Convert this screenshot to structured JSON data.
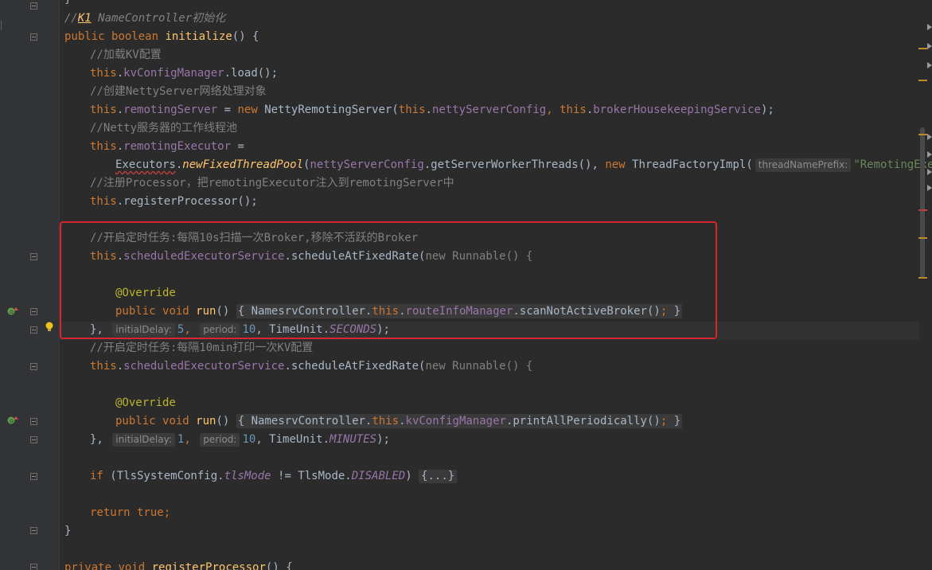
{
  "lines": [
    {
      "id": "l0",
      "text": "}"
    },
    {
      "id": "l1",
      "comment_prefix": "//",
      "comment_tag": "K1",
      "comment_rest": " NameController初始化"
    },
    {
      "kw1": "public",
      "kw2": "boolean",
      "method": "initialize",
      "rest": "() {"
    },
    {
      "comment": "//加载KV配置"
    },
    {
      "this": "this",
      "field": "kvConfigManager",
      "rest1": ".",
      "method": "load",
      "rest2": "();"
    },
    {
      "comment": "//创建NettyServer网络处理对象"
    },
    {
      "this": "this",
      "field": "remotingServer",
      "op": " = ",
      "kw": "new",
      "cls": " NettyRemotingServer(",
      "this2": "this",
      "field2": "nettyServerConfig",
      "sep": ", ",
      "this3": "this",
      "field3": "brokerHousekeepingService",
      "end": ");"
    },
    {
      "comment": "//Netty服务器的工作线程池"
    },
    {
      "this": "this",
      "field": "remotingExecutor",
      "rest": " ="
    },
    {
      "cls": "Executors",
      "dot": ".",
      "smethod": "newFixedThreadPool",
      "open": "(",
      "field": "nettyServerConfig",
      "call": ".getServerWorkerThreads(), ",
      "kw": "new",
      "cls2": " ThreadFactoryImpl(",
      "hint": "threadNamePrefix:",
      "str": "\"RemotingExecutorThread_\""
    },
    {
      "comment": "//注册Processor，把remotingExecutor注入到remotingServer中"
    },
    {
      "this": "this",
      "rest": ".registerProcessor();"
    },
    {
      "comment": "//开启定时任务:每隔10s扫描一次Broker,移除不活跃的Broker"
    },
    {
      "this": "this",
      "field": "scheduledExecutorService",
      "call": ".scheduleAtFixedRate(",
      "dim": "new Runnable() {"
    },
    {
      "annotation": "@Override"
    },
    {
      "kw1": "public",
      "kw2": "void",
      "method": "run",
      "paren": "() ",
      "ob": "{",
      "cls": " NamesrvController.",
      "this": "this",
      "dot": ".",
      "field": "routeInfoManager",
      "call": ".scanNotActiveBroker()",
      "semi": ";",
      "cb": " }"
    },
    {
      "close": "}, ",
      "hint1": "initialDelay:",
      "num1": "5",
      "sep": ", ",
      "hint2": "period:",
      "num2": "10",
      "sep2": ", TimeUnit.",
      "sfield": "SECONDS",
      "end": ");"
    },
    {
      "comment": "//开启定时任务:每隔10min打印一次KV配置"
    },
    {
      "this": "this",
      "field": "scheduledExecutorService",
      "call": ".scheduleAtFixedRate(",
      "dim": "new Runnable() {"
    },
    {
      "annotation": "@Override"
    },
    {
      "kw1": "public",
      "kw2": "void",
      "method": "run",
      "paren": "() ",
      "ob": "{",
      "cls": " NamesrvController.",
      "this": "this",
      "dot": ".",
      "field": "kvConfigManager",
      "call": ".printAllPeriodically()",
      "semi": ";",
      "cb": " }"
    },
    {
      "close": "}, ",
      "hint1": "initialDelay:",
      "num1": "1",
      "sep": ", ",
      "hint2": "period:",
      "num2": "10",
      "sep2": ", TimeUnit.",
      "sfield": "MINUTES",
      "end": ");"
    },
    {
      "kw": "if",
      "open": " (TlsSystemConfig.",
      "sfield": "tlsMode",
      "op": " != TlsMode.",
      "sfield2": "DISABLED",
      "close": ") ",
      "folded": "{...}"
    },
    {
      "kw": "return",
      "kw2": " true",
      "semi": ";"
    },
    {
      "brace": "}"
    },
    {
      "kw1": "private",
      "kw2": "void",
      "method": "registerProcessor",
      "rest": "() {"
    }
  ],
  "colors": {
    "background": "#2b2b2b",
    "gutter": "#313335",
    "keyword": "#cc7832",
    "field": "#9876aa",
    "method": "#ffc66d",
    "comment": "#808080",
    "number": "#6897bb",
    "string": "#6a8759",
    "highlight_border": "#d9252e"
  },
  "icons": {
    "run_gutter": "run-override-icon",
    "bulb": "intention-bulb-icon"
  }
}
